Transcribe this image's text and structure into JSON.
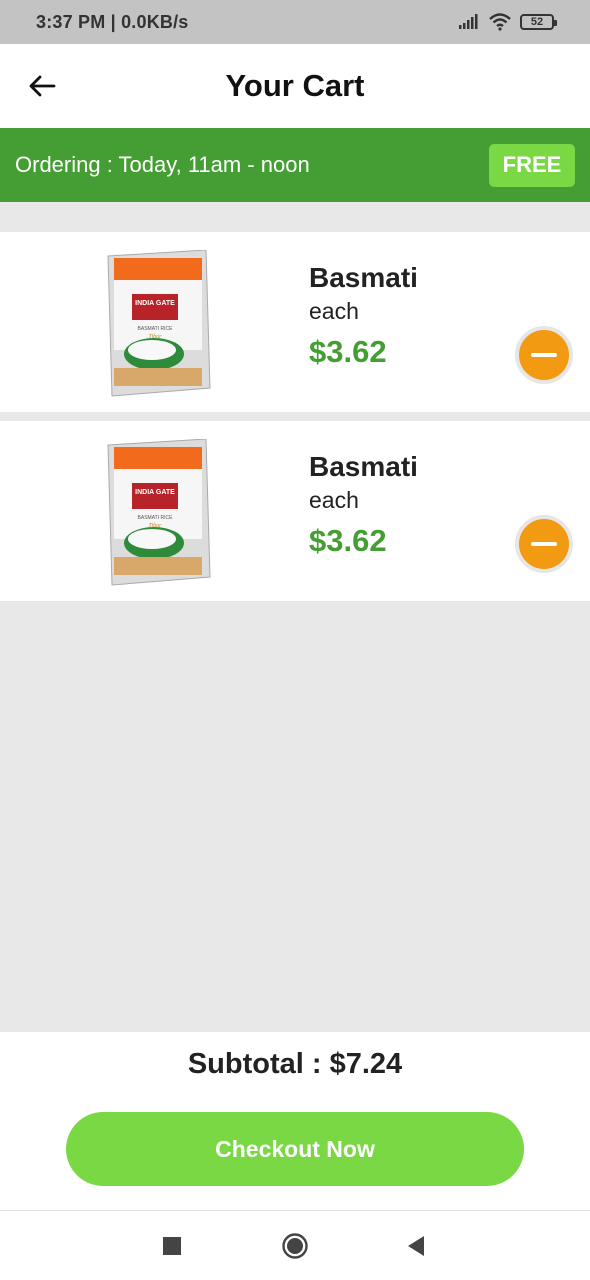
{
  "status_bar": {
    "time_speed": "3:37 PM | 0.0KB/s",
    "battery": "52"
  },
  "header": {
    "title": "Your Cart"
  },
  "banner": {
    "ordering_text": "Ordering : Today, 11am - noon",
    "badge": "FREE"
  },
  "cart_items": [
    {
      "name": "Basmati",
      "unit": "each",
      "price": "$3.62",
      "image_label": "INDIA GATE",
      "image_sublabel": "BASMATI RICE",
      "image_subtitle": "Tibar"
    },
    {
      "name": "Basmati",
      "unit": "each",
      "price": "$3.62",
      "image_label": "INDIA GATE",
      "image_sublabel": "BASMATI RICE",
      "image_subtitle": "Tibar"
    }
  ],
  "footer": {
    "subtotal": "Subtotal : $7.24",
    "checkout_label": "Checkout Now"
  },
  "colors": {
    "brand_green": "#459e33",
    "accent_green": "#79d843",
    "remove_orange": "#f29a12"
  },
  "icons": {
    "back": "arrow-left-icon",
    "remove": "minus-icon",
    "nav_recent": "square-icon",
    "nav_home": "circle-icon",
    "nav_back": "triangle-back-icon"
  }
}
